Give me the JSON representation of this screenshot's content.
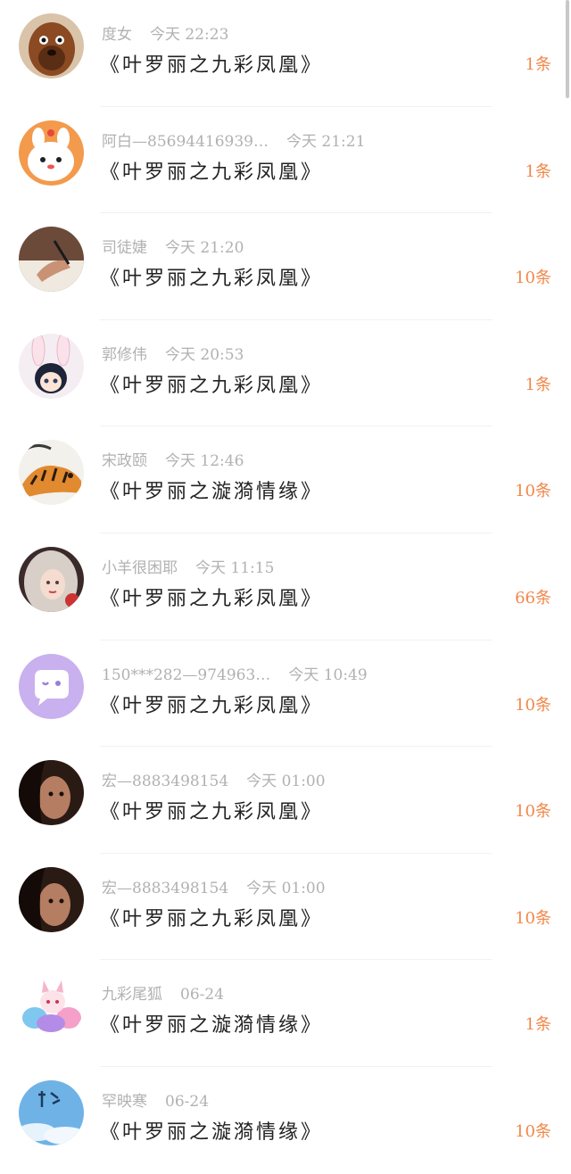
{
  "messages": [
    {
      "name": "度女",
      "time": "今天 22:23",
      "title": "《叶罗丽之九彩凤凰》",
      "count": "1条",
      "avatar": "dog-avatar"
    },
    {
      "name": "阿白—85694416939…",
      "time": "今天 21:21",
      "title": "《叶罗丽之九彩凤凰》",
      "count": "1条",
      "avatar": "bunny-cartoon-avatar"
    },
    {
      "name": "司徒婕",
      "time": "今天 21:20",
      "title": "《叶罗丽之九彩凤凰》",
      "count": "10条",
      "avatar": "hand-writing-avatar"
    },
    {
      "name": "郭修伟",
      "time": "今天 20:53",
      "title": "《叶罗丽之九彩凤凰》",
      "count": "1条",
      "avatar": "bunny-ear-girl-avatar"
    },
    {
      "name": "宋政颐",
      "time": "今天 12:46",
      "title": "《叶罗丽之漩漪情缘》",
      "count": "10条",
      "avatar": "tiger-avatar"
    },
    {
      "name": "小羊很困耶",
      "time": "今天 11:15",
      "title": "《叶罗丽之九彩凤凰》",
      "count": "66条",
      "avatar": "anime-girl-avatar"
    },
    {
      "name": "150***282—974963…",
      "time": "今天 10:49",
      "title": "《叶罗丽之九彩凤凰》",
      "count": "10条",
      "avatar": "chat-bubble-avatar"
    },
    {
      "name": "宏—8883498154",
      "time": "今天 01:00",
      "title": "《叶罗丽之九彩凤凰》",
      "count": "10条",
      "avatar": "portrait-photo-avatar"
    },
    {
      "name": "宏—8883498154",
      "time": "今天 01:00",
      "title": "《叶罗丽之九彩凤凰》",
      "count": "10条",
      "avatar": "portrait-photo-avatar"
    },
    {
      "name": "九彩尾狐",
      "time": "06-24",
      "title": "《叶罗丽之漩漪情缘》",
      "count": "1条",
      "avatar": "fox-avatar"
    },
    {
      "name": "罕映寒",
      "time": "06-24",
      "title": "《叶罗丽之漩漪情缘》",
      "count": "10条",
      "avatar": "sky-calligraphy-avatar"
    }
  ],
  "colors": {
    "count": "#f0874a",
    "meta": "#b1b1b1",
    "title": "#222222"
  }
}
